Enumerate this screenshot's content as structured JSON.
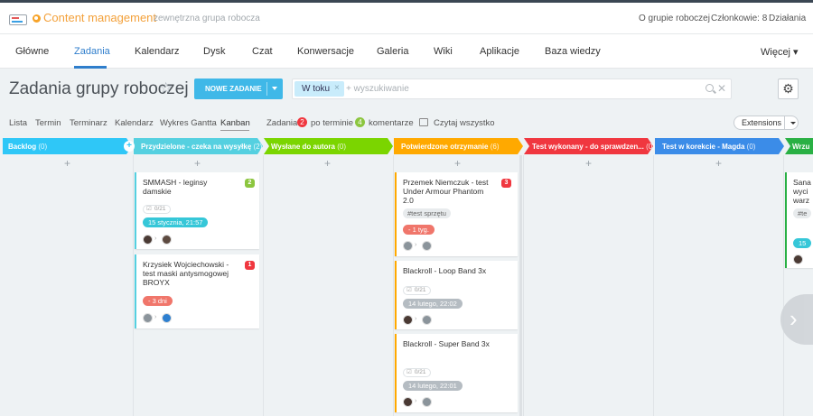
{
  "header": {
    "group_title": "Content management",
    "group_subtitle": "zewnętrzna grupa robocza",
    "links": [
      "O grupie roboczej",
      "Członkowie: 8",
      "Działania"
    ]
  },
  "nav": {
    "items": [
      "Główne",
      "Zadania",
      "Kalendarz",
      "Dysk",
      "Czat",
      "Konwersacje",
      "Galeria",
      "Wiki",
      "Aplikacje",
      "Baza wiedzy"
    ],
    "more": "Więcej ▾",
    "active": "Zadania"
  },
  "toolbar": {
    "page_title": "Zadania grupy roboczej",
    "star": "☆",
    "new_task": "NOWE ZADANIE",
    "filter_chip": "W toku",
    "chip_close": "×",
    "search_placeholder": "+ wyszukiwanie",
    "clear": "✕",
    "settings": "⚙"
  },
  "views": {
    "tabs": [
      "Lista",
      "Termin",
      "Terminarz",
      "Kalendarz",
      "Wykres Gantta",
      "Kanban"
    ],
    "active": "Kanban",
    "tasks_label": "Zadania:",
    "overdue_count": "2",
    "overdue_label": "po terminie",
    "comments_count": "4",
    "comments_label": "komentarze",
    "read_all": "Czytaj wszystko",
    "extensions": "Extensions"
  },
  "columns": [
    {
      "title": "Backlog",
      "count": "(0)",
      "color": "#2fc7f7"
    },
    {
      "title": "Przydzielone - czeka na wysyłkę",
      "count": "(2)",
      "color": "#55d0e0"
    },
    {
      "title": "Wysłane do autora",
      "count": "(0)",
      "color": "#7bd500"
    },
    {
      "title": "Potwierdzone otrzymanie",
      "count": "(6)",
      "color": "#ffa900"
    },
    {
      "title": "Test wykonany - do sprawdzen...",
      "count": "(0)",
      "color": "#f0373f"
    },
    {
      "title": "Test w korekcie - Magda",
      "count": "(0)",
      "color": "#3b8ce8"
    },
    {
      "title": "Wrzu",
      "count": "",
      "color": "#29b044"
    }
  ],
  "add_symbol": "+",
  "cards": {
    "c1": {
      "title": "SMMASH - leginsy damskie",
      "prio": "2",
      "check": "0/21",
      "date": "15 stycznia, 21:57"
    },
    "c2": {
      "title": "Krzysiek Wojciechowski - test maski antysmogowej BROYX",
      "prio": "1",
      "date": "- 3 dni"
    },
    "c3": {
      "title": "Przemek Niemczuk - test Under Armour Phantom 2.0",
      "prio": "3",
      "tag": "#test sprzętu",
      "date": "- 1 tyg."
    },
    "c4": {
      "title": "Blackroll - Loop Band 3x",
      "check": "0/21",
      "date": "14 lutego, 22:02"
    },
    "c5": {
      "title": "Blackroll - Super Band 3x",
      "check": "0/21",
      "date": "14 lutego, 22:01"
    },
    "c6": {
      "title": "Sana wyci warz",
      "tag": "#te",
      "date": "15"
    }
  },
  "colors": {
    "accent": "#2f7ecc",
    "group_title": "#f3a13b",
    "date_teal": "#36c7d8",
    "date_red": "#f0766b",
    "date_grey": "#b5bcc2",
    "prio_red": "#f0373f",
    "prio_green": "#8cc63f"
  }
}
